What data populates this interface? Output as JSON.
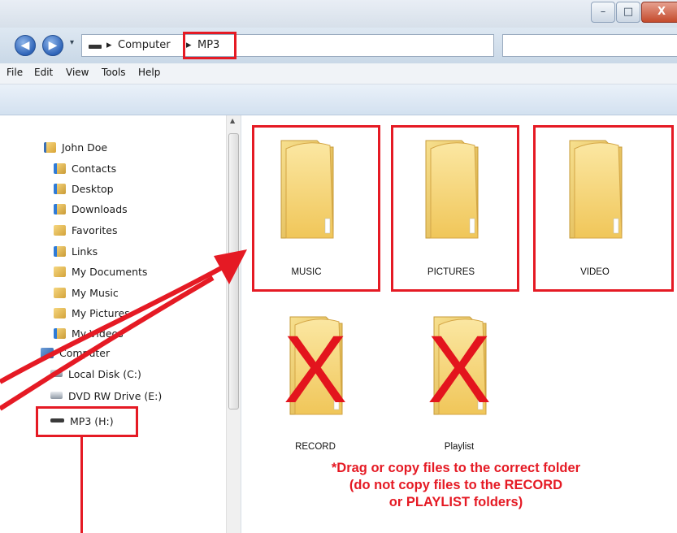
{
  "window": {
    "controls": {
      "minimize": "–",
      "maximize": "□",
      "close": "X"
    }
  },
  "address_bar": {
    "breadcrumb": [
      "Computer",
      "MP3"
    ],
    "separator": "▸",
    "dropdown_glyph": "▾",
    "refresh_glyph": "⇆"
  },
  "nav_buttons": {
    "back": "◀",
    "forward": "▶",
    "history": "▾"
  },
  "menu": [
    "File",
    "Edit",
    "View",
    "Tools",
    "Help"
  ],
  "nav_pane": {
    "items": [
      {
        "label": "John Doe",
        "icon": "user-folder-icon"
      },
      {
        "label": "Contacts",
        "icon": "contacts-folder-icon"
      },
      {
        "label": "Desktop",
        "icon": "desktop-folder-icon"
      },
      {
        "label": "Downloads",
        "icon": "downloads-folder-icon"
      },
      {
        "label": "Favorites",
        "icon": "favorites-folder-icon"
      },
      {
        "label": "Links",
        "icon": "links-folder-icon"
      },
      {
        "label": "My Documents",
        "icon": "documents-folder-icon"
      },
      {
        "label": "My Music",
        "icon": "music-folder-icon"
      },
      {
        "label": "My Pictures",
        "icon": "pictures-folder-icon"
      },
      {
        "label": "My Videos",
        "icon": "videos-folder-icon"
      },
      {
        "label": "Computer",
        "icon": "computer-icon"
      },
      {
        "label": "Local Disk (C:)",
        "icon": "local-disk-icon"
      },
      {
        "label": "DVD RW Drive (E:)",
        "icon": "dvd-drive-icon"
      },
      {
        "label": "MP3 (H:)",
        "icon": "removable-drive-icon"
      }
    ]
  },
  "folders": [
    {
      "label": "MUSIC",
      "status": "correct"
    },
    {
      "label": "PICTURES",
      "status": "correct"
    },
    {
      "label": "VIDEO",
      "status": "correct"
    },
    {
      "label": "RECORD",
      "status": "do-not-use"
    },
    {
      "label": "Playlist",
      "status": "do-not-use"
    }
  ],
  "annotation": {
    "x_mark": "X",
    "note_lines": [
      "*Drag or copy files to the correct folder",
      "(do not copy files to the RECORD",
      "or PLAYLIST folders)"
    ]
  },
  "colors": {
    "highlight": "#e51a24",
    "folder": "#f2cf6b",
    "window_blue": "#c9d8e7"
  }
}
